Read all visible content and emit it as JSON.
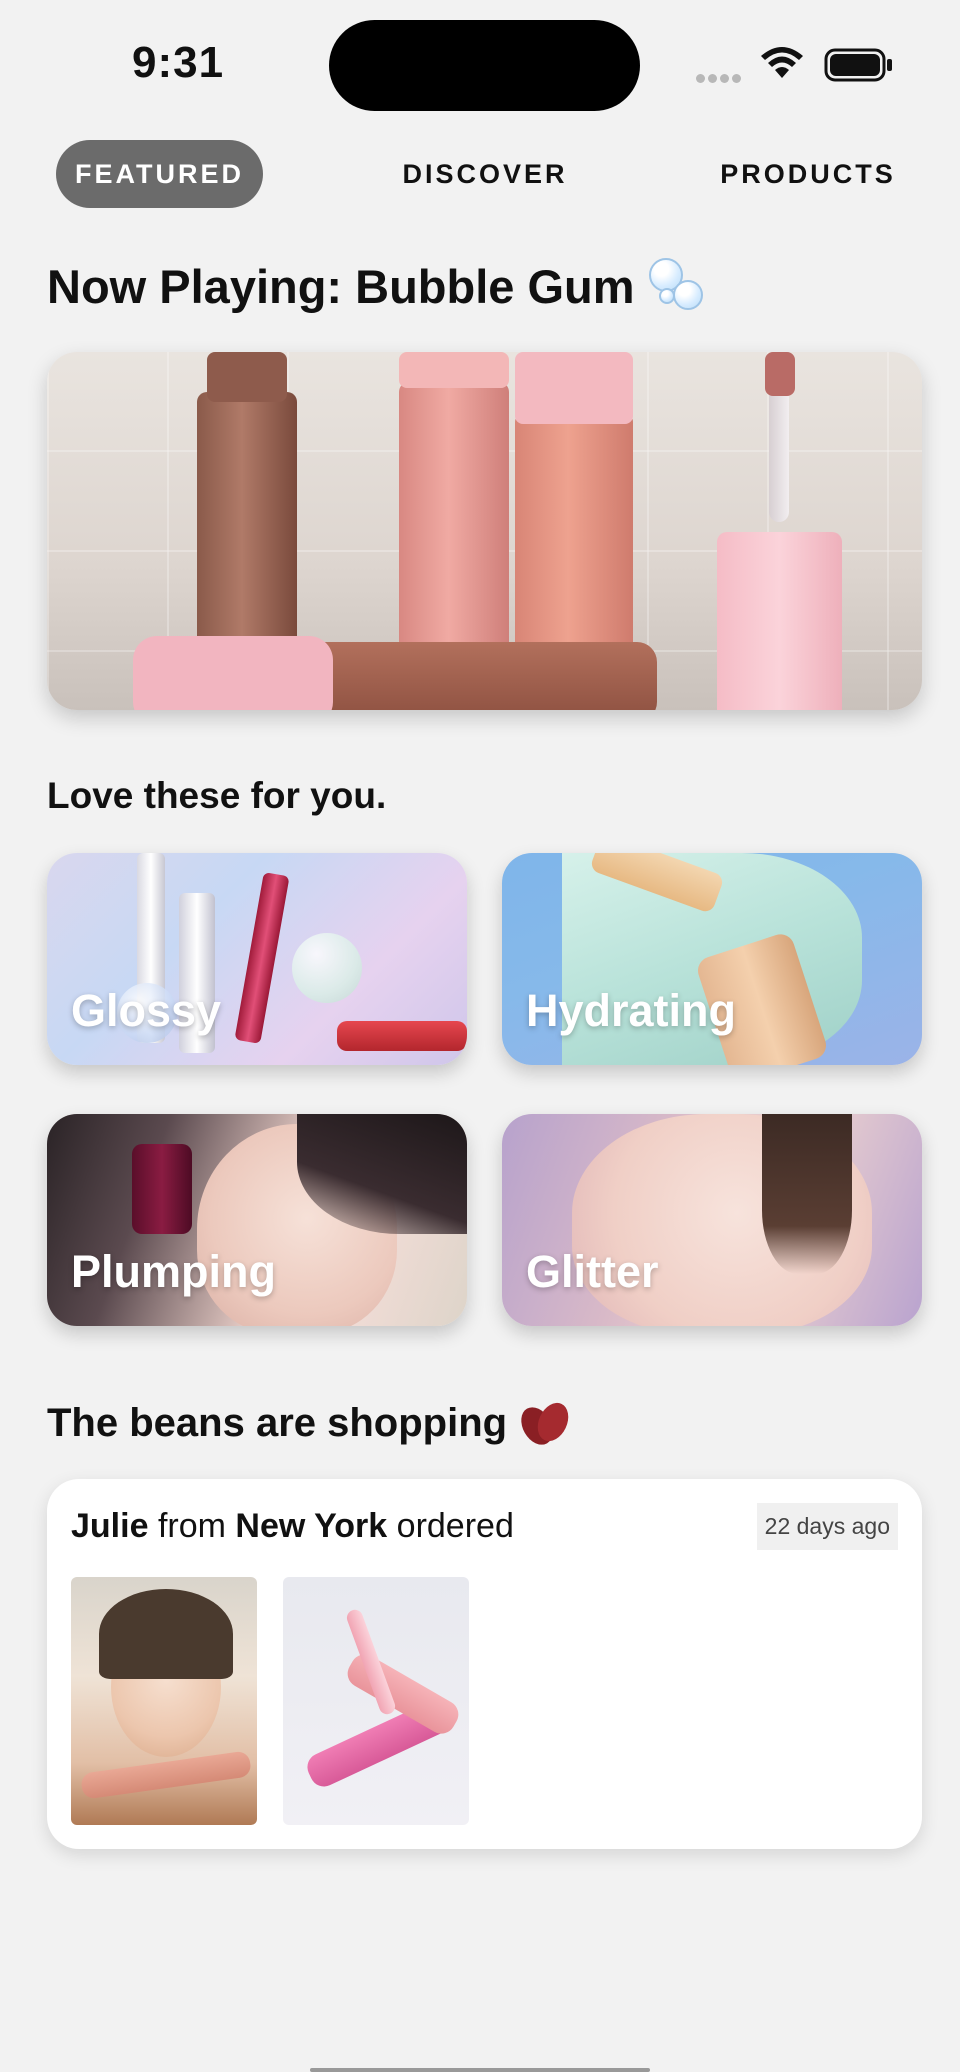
{
  "status_bar": {
    "time": "9:31"
  },
  "tabs": [
    {
      "label": "FEATURED",
      "active": true
    },
    {
      "label": "DISCOVER",
      "active": false
    },
    {
      "label": "PRODUCTS",
      "active": false
    }
  ],
  "now_playing": {
    "title": "Now Playing: Bubble Gum",
    "emoji_icon": "bubbles-icon",
    "hero_image": "pink lip gloss bottles on tiled surface"
  },
  "recommendations": {
    "title": "Love these for you.",
    "categories": [
      {
        "label": "Glossy"
      },
      {
        "label": "Hydrating"
      },
      {
        "label": "Plumping"
      },
      {
        "label": "Glitter"
      }
    ]
  },
  "shopping": {
    "title": "The beans are shopping",
    "emoji_icon": "beans-icon",
    "order": {
      "name": "Julie",
      "from_text": "from",
      "city": "New York",
      "ordered_text": "ordered",
      "time_ago": "22 days ago"
    }
  },
  "colors": {
    "background": "#f2f2f2",
    "active_tab": "#6b6b6b",
    "card": "#ffffff"
  }
}
